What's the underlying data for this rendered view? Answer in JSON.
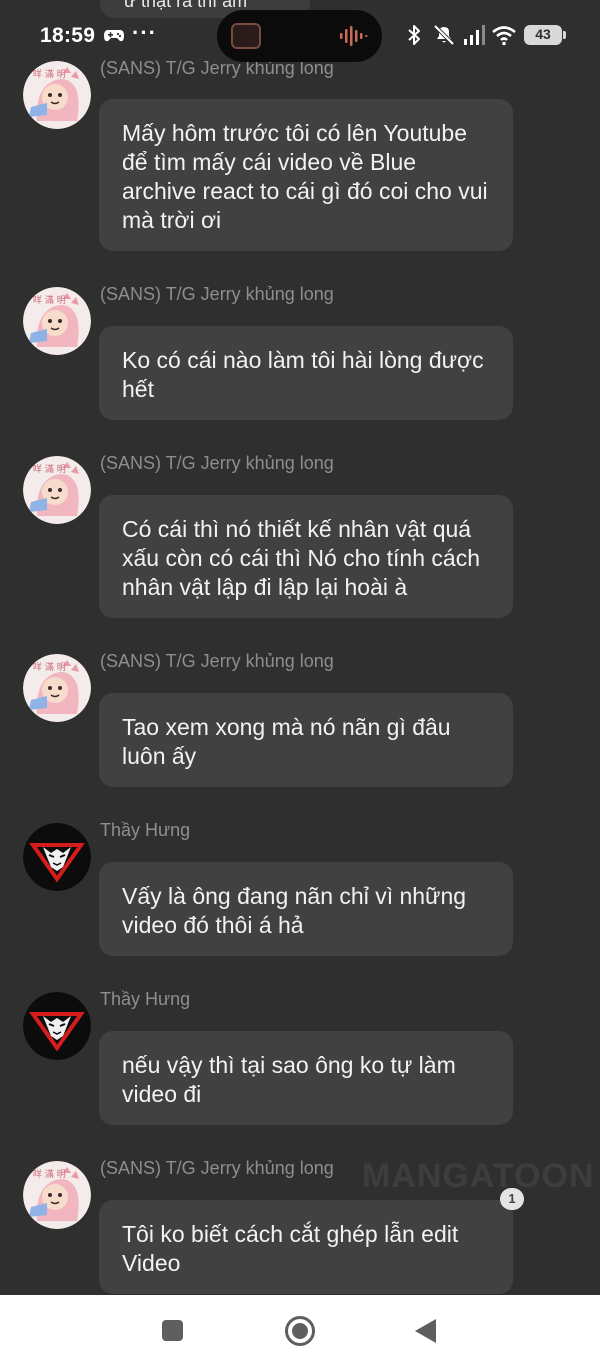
{
  "status_bar": {
    "time": "18:59",
    "dots": "···",
    "battery": "43"
  },
  "top_remnant": "ư thật ra thì ấm",
  "messages": [
    {
      "sender": "(SANS) T/G Jerry khủng long",
      "text": "Mấy hôm trước tôi có lên Youtube để tìm mấy cái video về Blue archive react to cái gì đó coi cho vui mà trời ơi",
      "avatar": "pink-dinosaur-avatar"
    },
    {
      "sender": "(SANS) T/G Jerry khủng long",
      "text": "Ko có cái nào làm tôi hài lòng được hết",
      "avatar": "pink-dinosaur-avatar"
    },
    {
      "sender": "(SANS) T/G Jerry khủng long",
      "text": "Có cái thì nó thiết kế nhân vật quá xấu còn có cái thì Nó cho tính cách nhân vật lập đi lập lại hoài à",
      "avatar": "pink-dinosaur-avatar"
    },
    {
      "sender": "(SANS) T/G Jerry khủng long",
      "text": "Tao xem xong mà nó nãn gì đâu luôn ấy",
      "avatar": "pink-dinosaur-avatar"
    },
    {
      "sender": "Thầy Hưng",
      "text": "Vấy là ông đang nãn chỉ vì những video đó thôi á hả",
      "avatar": "red-dragon-emblem-avatar"
    },
    {
      "sender": "Thầy Hưng",
      "text": "nếu vậy thì tại sao ông ko tự làm video đi",
      "avatar": "red-dragon-emblem-avatar"
    },
    {
      "sender": "(SANS) T/G Jerry khủng long",
      "text": "Tôi ko biết cách cắt ghép lẫn edit Video",
      "avatar": "pink-dinosaur-avatar",
      "reaction_count": "1"
    }
  ],
  "watermark": "MANGATOON",
  "colors": {
    "background": "#2f2f2f",
    "bubble": "#414141",
    "sender_name": "#8e8e8e",
    "message_text": "#f2f2f2",
    "nav_bar": "#ffffff"
  }
}
